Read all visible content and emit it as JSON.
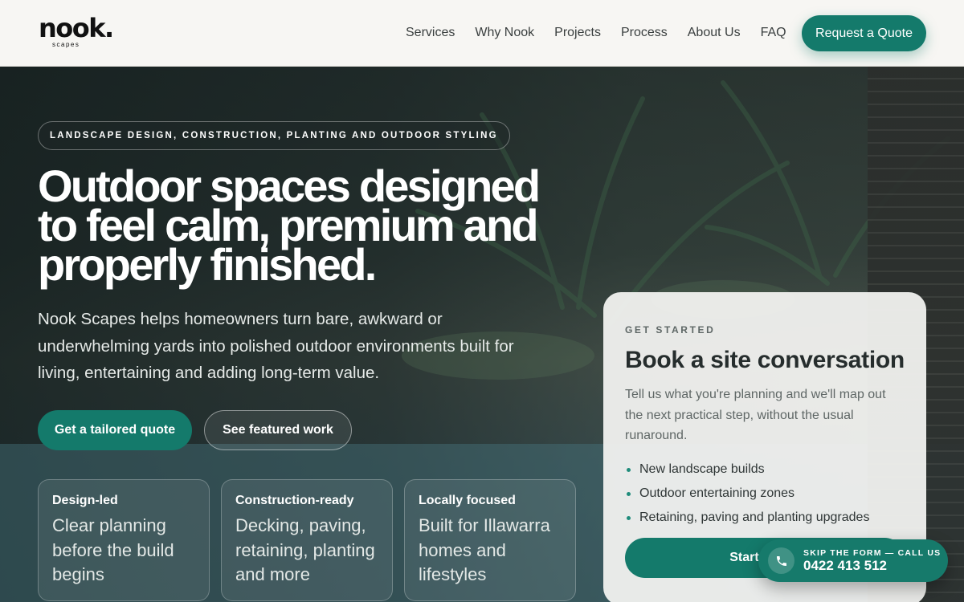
{
  "header": {
    "logo_main": "nook.",
    "logo_sub": "scapes",
    "nav": [
      "Services",
      "Why Nook",
      "Projects",
      "Process",
      "About Us",
      "FAQ"
    ],
    "cta": "Request a Quote"
  },
  "hero": {
    "eyebrow": "LANDSCAPE DESIGN, CONSTRUCTION, PLANTING AND OUTDOOR STYLING",
    "headline": "Outdoor spaces designed to feel calm, premium and properly finished.",
    "lead": "Nook Scapes helps homeowners turn bare, awkward or underwhelming yards into polished outdoor environments built for living, entertaining and adding long-term value.",
    "primary_button": "Get a tailored quote",
    "secondary_button": "See featured work",
    "features": [
      {
        "title": "Design-led",
        "text": "Clear planning before the build begins"
      },
      {
        "title": "Construction-ready",
        "text": "Decking, paving, retaining, planting and more"
      },
      {
        "title": "Locally focused",
        "text": "Built for Illawarra homes and lifestyles"
      }
    ]
  },
  "form_card": {
    "eyebrow": "GET STARTED",
    "title": "Book a site conversation",
    "text": "Tell us what you're planning and we'll map out the next practical step, without the usual runaround.",
    "list": [
      "New landscape builds",
      "Outdoor entertaining zones",
      "Retaining, paving and planting upgrades"
    ],
    "button": "Start yo"
  },
  "call_pill": {
    "small": "SKIP THE FORM — CALL US",
    "number": "0422 413 512",
    "icon": "phone-icon"
  },
  "colors": {
    "accent": "#147a6b",
    "header_bg": "#f7f6f3",
    "card_bg": "#f3f3f1"
  }
}
